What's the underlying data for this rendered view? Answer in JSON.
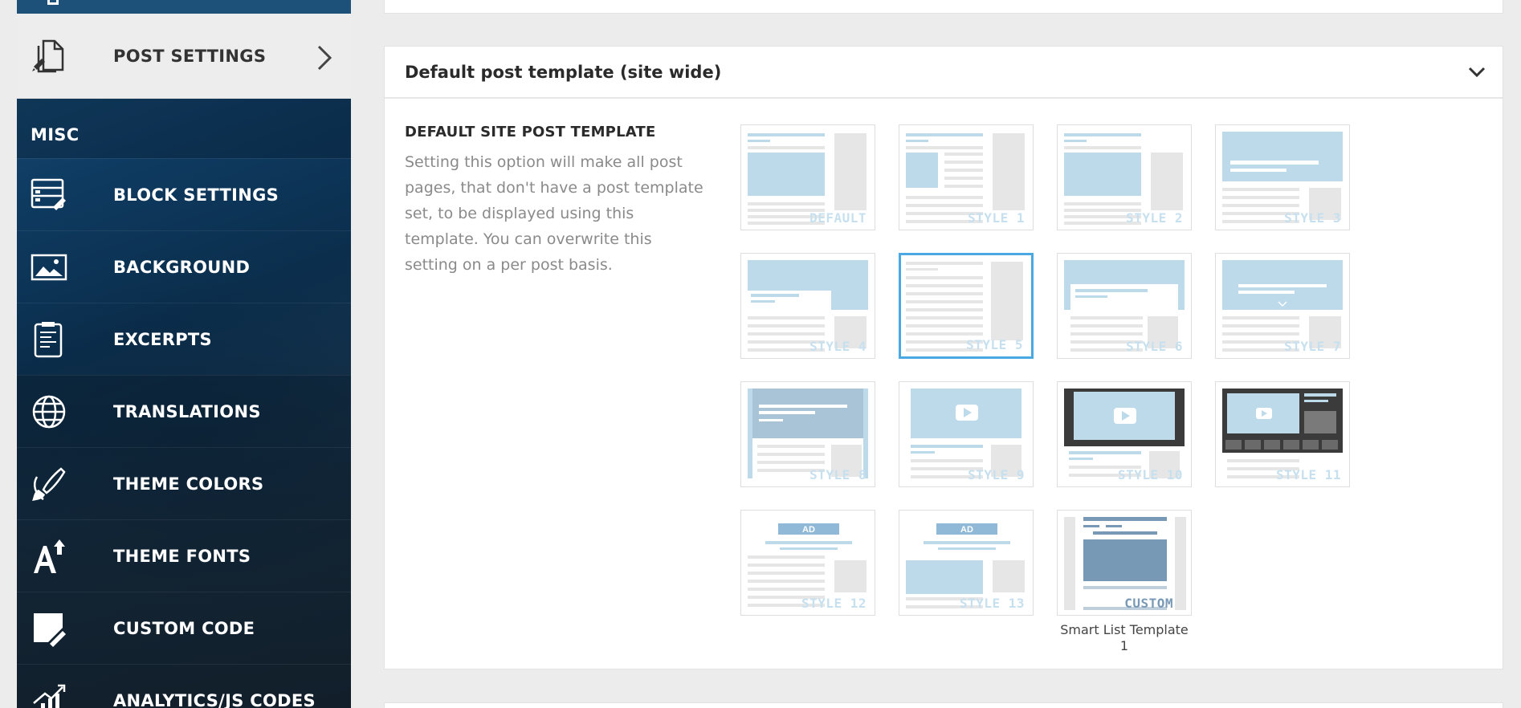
{
  "sidebar": {
    "active_item": {
      "label": "POST SETTINGS",
      "icon": "post-settings-icon"
    },
    "section_label": "MISC",
    "items": [
      {
        "label": "BLOCK SETTINGS",
        "icon": "block-settings-icon"
      },
      {
        "label": "BACKGROUND",
        "icon": "background-image-icon"
      },
      {
        "label": "EXCERPTS",
        "icon": "excerpts-icon"
      },
      {
        "label": "TRANSLATIONS",
        "icon": "globe-icon"
      },
      {
        "label": "THEME COLORS",
        "icon": "paint-brush-icon"
      },
      {
        "label": "THEME FONTS",
        "icon": "font-icon"
      },
      {
        "label": "CUSTOM CODE",
        "icon": "custom-code-icon"
      },
      {
        "label": "ANALYTICS/JS CODES",
        "icon": "analytics-icon"
      }
    ]
  },
  "panel": {
    "title": "Default post template (site wide)",
    "option_title": "DEFAULT SITE POST TEMPLATE",
    "option_description": "Setting this option will make all post pages, that don't have a post template set, to be displayed using this template. You can overwrite this setting on a per post basis.",
    "selected_template": "STYLE 5",
    "templates": [
      {
        "label": "DEFAULT"
      },
      {
        "label": "STYLE 1"
      },
      {
        "label": "STYLE 2"
      },
      {
        "label": "STYLE 3"
      },
      {
        "label": "STYLE 4"
      },
      {
        "label": "STYLE 5"
      },
      {
        "label": "STYLE 6"
      },
      {
        "label": "STYLE 7"
      },
      {
        "label": "STYLE 8"
      },
      {
        "label": "STYLE 9"
      },
      {
        "label": "STYLE 10"
      },
      {
        "label": "STYLE 11"
      },
      {
        "label": "STYLE 12",
        "ad_label": "AD"
      },
      {
        "label": "STYLE 13",
        "ad_label": "AD"
      },
      {
        "label": "CUSTOM",
        "caption": "Smart List Template 1"
      }
    ]
  },
  "colors": {
    "accent_selected": "#4aa8e2",
    "thumb_blue": "#bcdaea",
    "thumb_gray": "#e6e6e6"
  }
}
